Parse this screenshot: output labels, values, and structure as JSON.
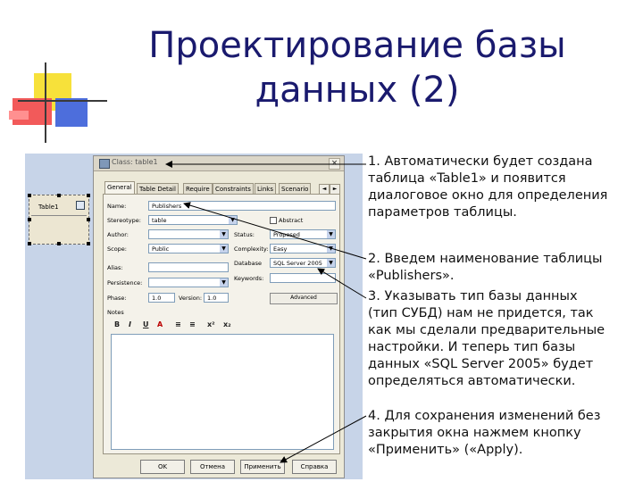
{
  "slide": {
    "title_line1": "Проектирование базы",
    "title_line2": "данных (2)",
    "text": {
      "p1": [
        "1. Автоматически будет создана",
        "таблица «Table1» и появится",
        "диалоговое окно для определения",
        "параметров таблицы."
      ],
      "p2": [
        "2. Введем наименование таблицы",
        "«Publishers»."
      ],
      "p3": [
        "3. Указывать тип базы данных",
        "(тип СУБД) нам не придется, так",
        "как мы сделали предварительные",
        "настройки. И теперь тип базы",
        "данных «SQL Server 2005» будет",
        "определяться автоматически."
      ],
      "p4": [
        "4. Для сохранения изменений без",
        "закрытия окна нажмем кнопку",
        "«Применить» («Apply)."
      ]
    }
  },
  "screenshot": {
    "entity_label": "Table1",
    "window_title": "Class: table1",
    "close_glyph": "×",
    "tabs": [
      "General",
      "Table Detail",
      "Require",
      "Constraints",
      "Links",
      "Scenario"
    ],
    "tab_prev": "◄",
    "tab_next": "►",
    "fields": {
      "name_label": "Name:",
      "name_value": "Publishers",
      "stereotype_label": "Stereotype:",
      "stereotype_value": "table",
      "abstract_label": "Abstract",
      "author_label": "Author:",
      "author_value": "",
      "status_label": "Status:",
      "status_value": "Proposed",
      "scope_label": "Scope:",
      "scope_value": "Public",
      "complexity_label": "Complexity:",
      "complexity_value": "Easy",
      "database_label": "Database",
      "database_value": "SQL Server 2005",
      "alias_label": "Alias:",
      "alias_value": "",
      "keywords_label": "Keywords:",
      "keywords_value": "",
      "persistence_label": "Persistence:",
      "persistence_value": "",
      "phase_label": "Phase:",
      "phase_value": "1.0",
      "version_label": "Version:",
      "version_value": "1.0",
      "advanced_label": "Advanced",
      "notes_label": "Notes"
    },
    "format_buttons": [
      "B",
      "I",
      "U",
      "A",
      "≡",
      "≡",
      "x²",
      "x₂"
    ],
    "buttons": {
      "ok": "OK",
      "cancel": "Отмена",
      "apply": "Применить",
      "help": "Справка"
    }
  }
}
